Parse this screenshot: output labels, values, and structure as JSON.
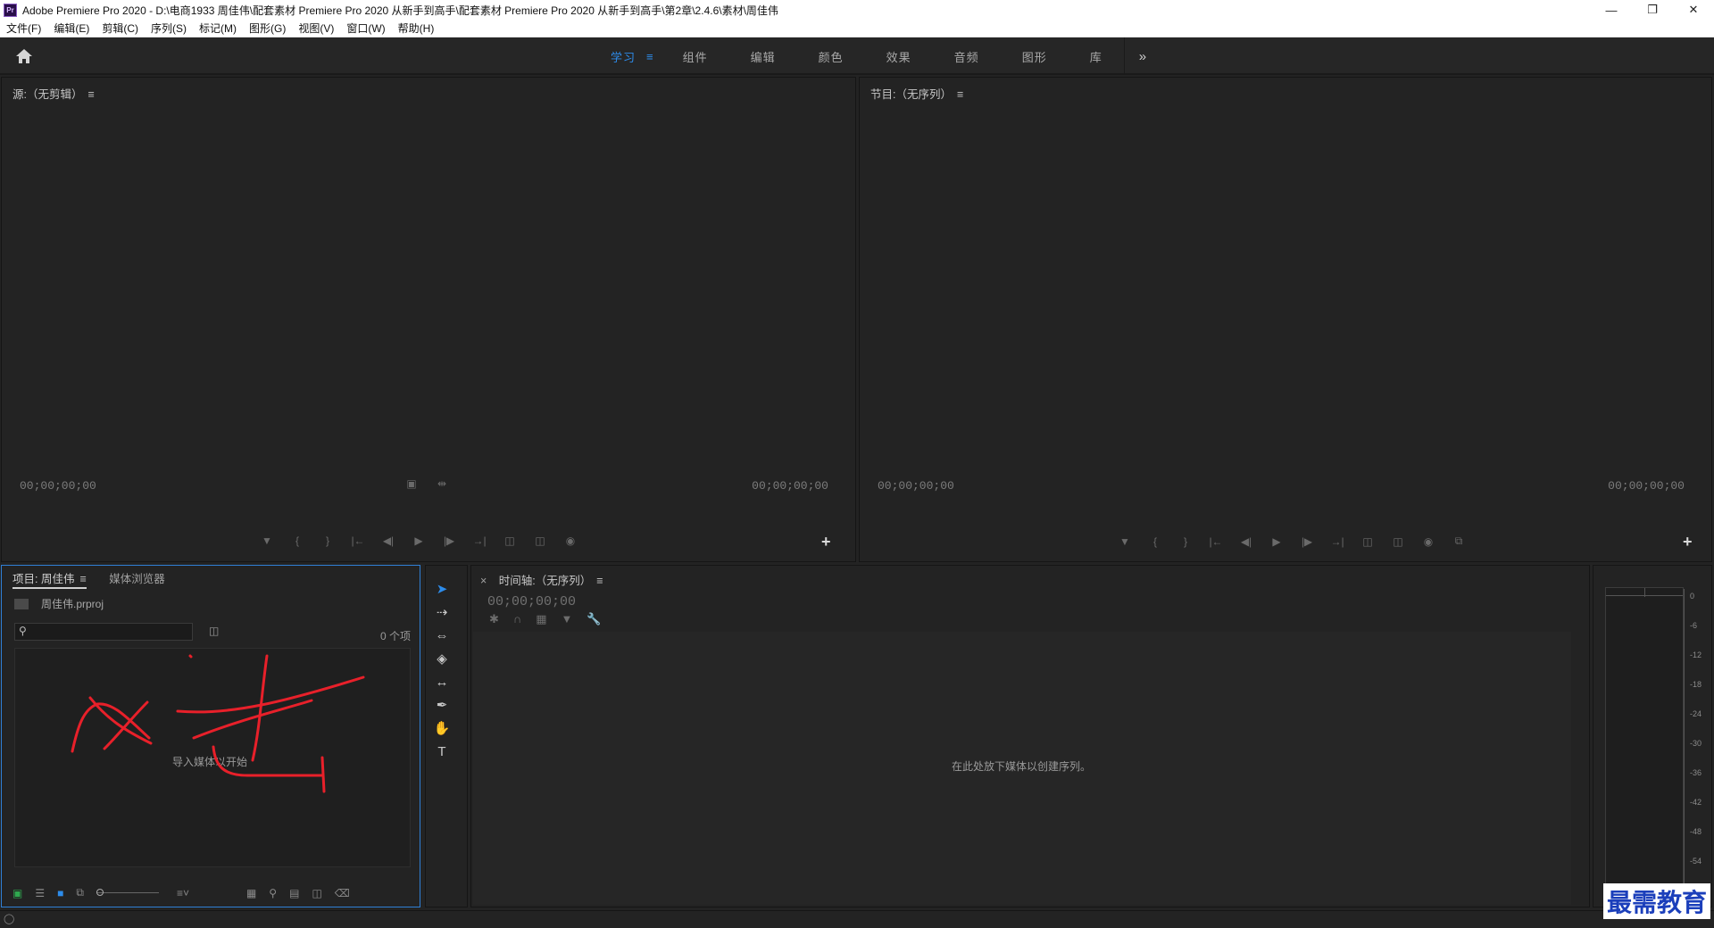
{
  "window": {
    "app_icon": "Pr",
    "title": "Adobe Premiere Pro 2020 - D:\\电商1933 周佳伟\\配套素材 Premiere Pro 2020 从新手到高手\\配套素材 Premiere Pro 2020 从新手到高手\\第2章\\2.4.6\\素材\\周佳伟",
    "controls": [
      "minimize-icon",
      "restore-icon",
      "close-icon"
    ]
  },
  "menu": [
    "文件(F)",
    "编辑(E)",
    "剪辑(C)",
    "序列(S)",
    "标记(M)",
    "图形(G)",
    "视图(V)",
    "窗口(W)",
    "帮助(H)"
  ],
  "workspaces": {
    "active": "学习",
    "tabs": [
      "组件",
      "编辑",
      "颜色",
      "效果",
      "音频",
      "图形",
      "库"
    ],
    "more": "»"
  },
  "source_monitor": {
    "title": "源:（无剪辑）",
    "timecode_left": "00;00;00;00",
    "timecode_right": "00;00;00;00"
  },
  "program_monitor": {
    "title": "节目:（无序列）",
    "timecode_left": "00;00;00;00",
    "timecode_right": "00;00;00;00"
  },
  "project": {
    "tab_active": "项目: 周佳伟",
    "tab_inactive": "媒体浏览器",
    "file": "周佳伟.prproj",
    "item_count": "0 个项",
    "hint": "导入媒体以开始"
  },
  "timeline": {
    "title": "时间轴:（无序列）",
    "close": "×",
    "timecode": "00;00;00;00",
    "hint": "在此处放下媒体以创建序列。"
  },
  "meter": {
    "scale": [
      "0",
      "-6",
      "-12",
      "-18",
      "-24",
      "-30",
      "-36",
      "-42",
      "-48",
      "-54"
    ]
  },
  "watermark": "最需教育",
  "colors": {
    "accent": "#2d8ceb",
    "panel_bg": "#232323",
    "annotation": "#e8202a"
  }
}
